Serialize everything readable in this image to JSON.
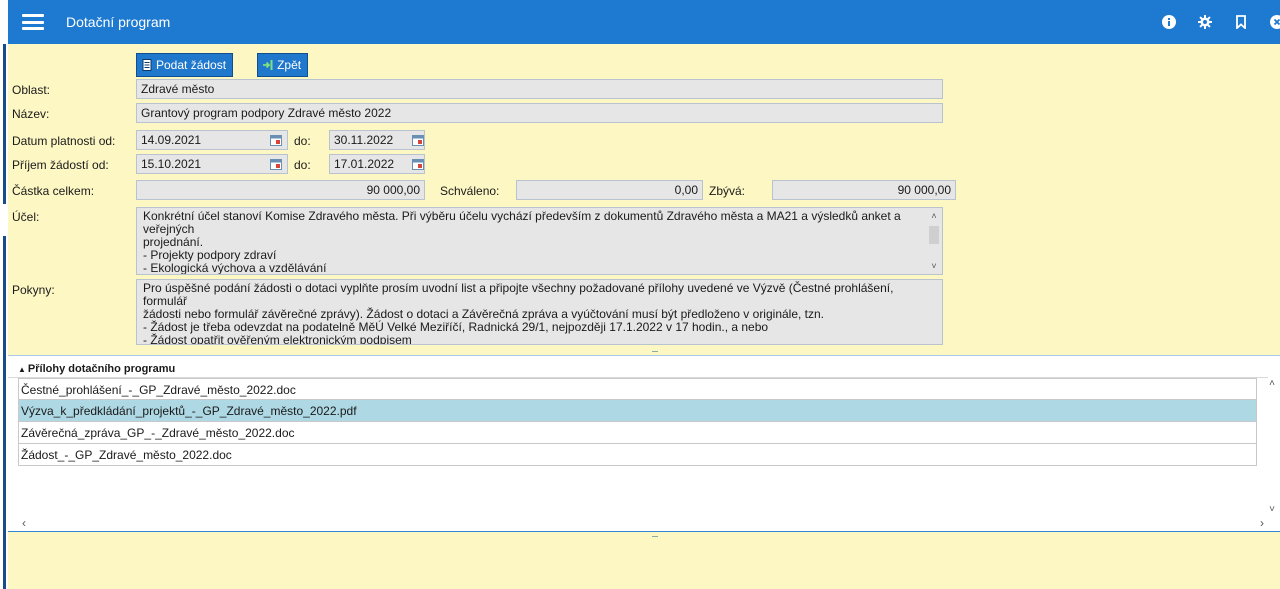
{
  "app": {
    "title": "Dotační program"
  },
  "toolbar": {
    "submit_label": "Podat žádost",
    "back_label": "Zpět"
  },
  "form": {
    "oblast_label": "Oblast:",
    "oblast_value": "Zdravé město",
    "nazev_label": "Název:",
    "nazev_value": "Grantový program podpory Zdravé město 2022",
    "platnost_label": "Datum platnosti od:",
    "platnost_od": "14.09.2021",
    "platnost_do_label": "do:",
    "platnost_do": "30.11.2022",
    "prijem_label": "Příjem žádostí od:",
    "prijem_od": "15.10.2021",
    "prijem_do_label": "do:",
    "prijem_do": "17.01.2022",
    "castka_label": "Částka celkem:",
    "castka_value": "90 000,00",
    "schvaleno_label": "Schváleno:",
    "schvaleno_value": "0,00",
    "zbyva_label": "Zbývá:",
    "zbyva_value": "90 000,00",
    "ucel_label": "Účel:",
    "ucel_lines": [
      "Konkrétní účel stanoví Komise Zdravého města. Při výběru účelu vychází především z dokumentů Zdravého města a MA21 a výsledků anket a veřejných",
      "projednání.",
      "- Projekty podpory zdraví",
      "- Ekologická výchova a vzdělávání"
    ],
    "pokyny_label": "Pokyny:",
    "pokyny_lines": [
      "Pro úspěšné podání žádosti o dotaci vyplňte prosím uvodní list a připojte všechny požadované přílohy uvedené ve Výzvě (Čestné prohlášení, formulář",
      "žádosti nebo formulář závěrečné zprávy). Žádost o dotaci a Závěrečná zpráva a vyúčtování musí být předloženo v originále, tzn.",
      "- Žádost je třeba odevzdat na podatelně MěÚ Velké Meziříčí, Radnická 29/1, nejpozději 17.1.2022 v 17 hodin., a nebo",
      "- Žádost opatřit ověřeným elektronickým podpisem"
    ]
  },
  "attachments": {
    "header": "Přílohy dotačního programu",
    "items": [
      "Čestné_prohlášení_-_GP_Zdravé_město_2022.doc",
      "Výzva_k_předkládání_projektů_-_GP_Zdravé_město_2022.pdf",
      "Závěrečná_zpráva_GP_-_Zdravé_město_2022.doc",
      "Žádost_-_GP_Zdravé_město_2022.doc"
    ],
    "selected_index": 1
  },
  "colors": {
    "topbar": "#1e7ad0",
    "form_bg": "#fdf7c4",
    "selected_row": "#aed8e4"
  },
  "icons": [
    "menu-icon",
    "info-icon",
    "gear-icon",
    "bookmark-icon",
    "close-icon",
    "calendar-icon",
    "document-icon",
    "exit-icon"
  ]
}
